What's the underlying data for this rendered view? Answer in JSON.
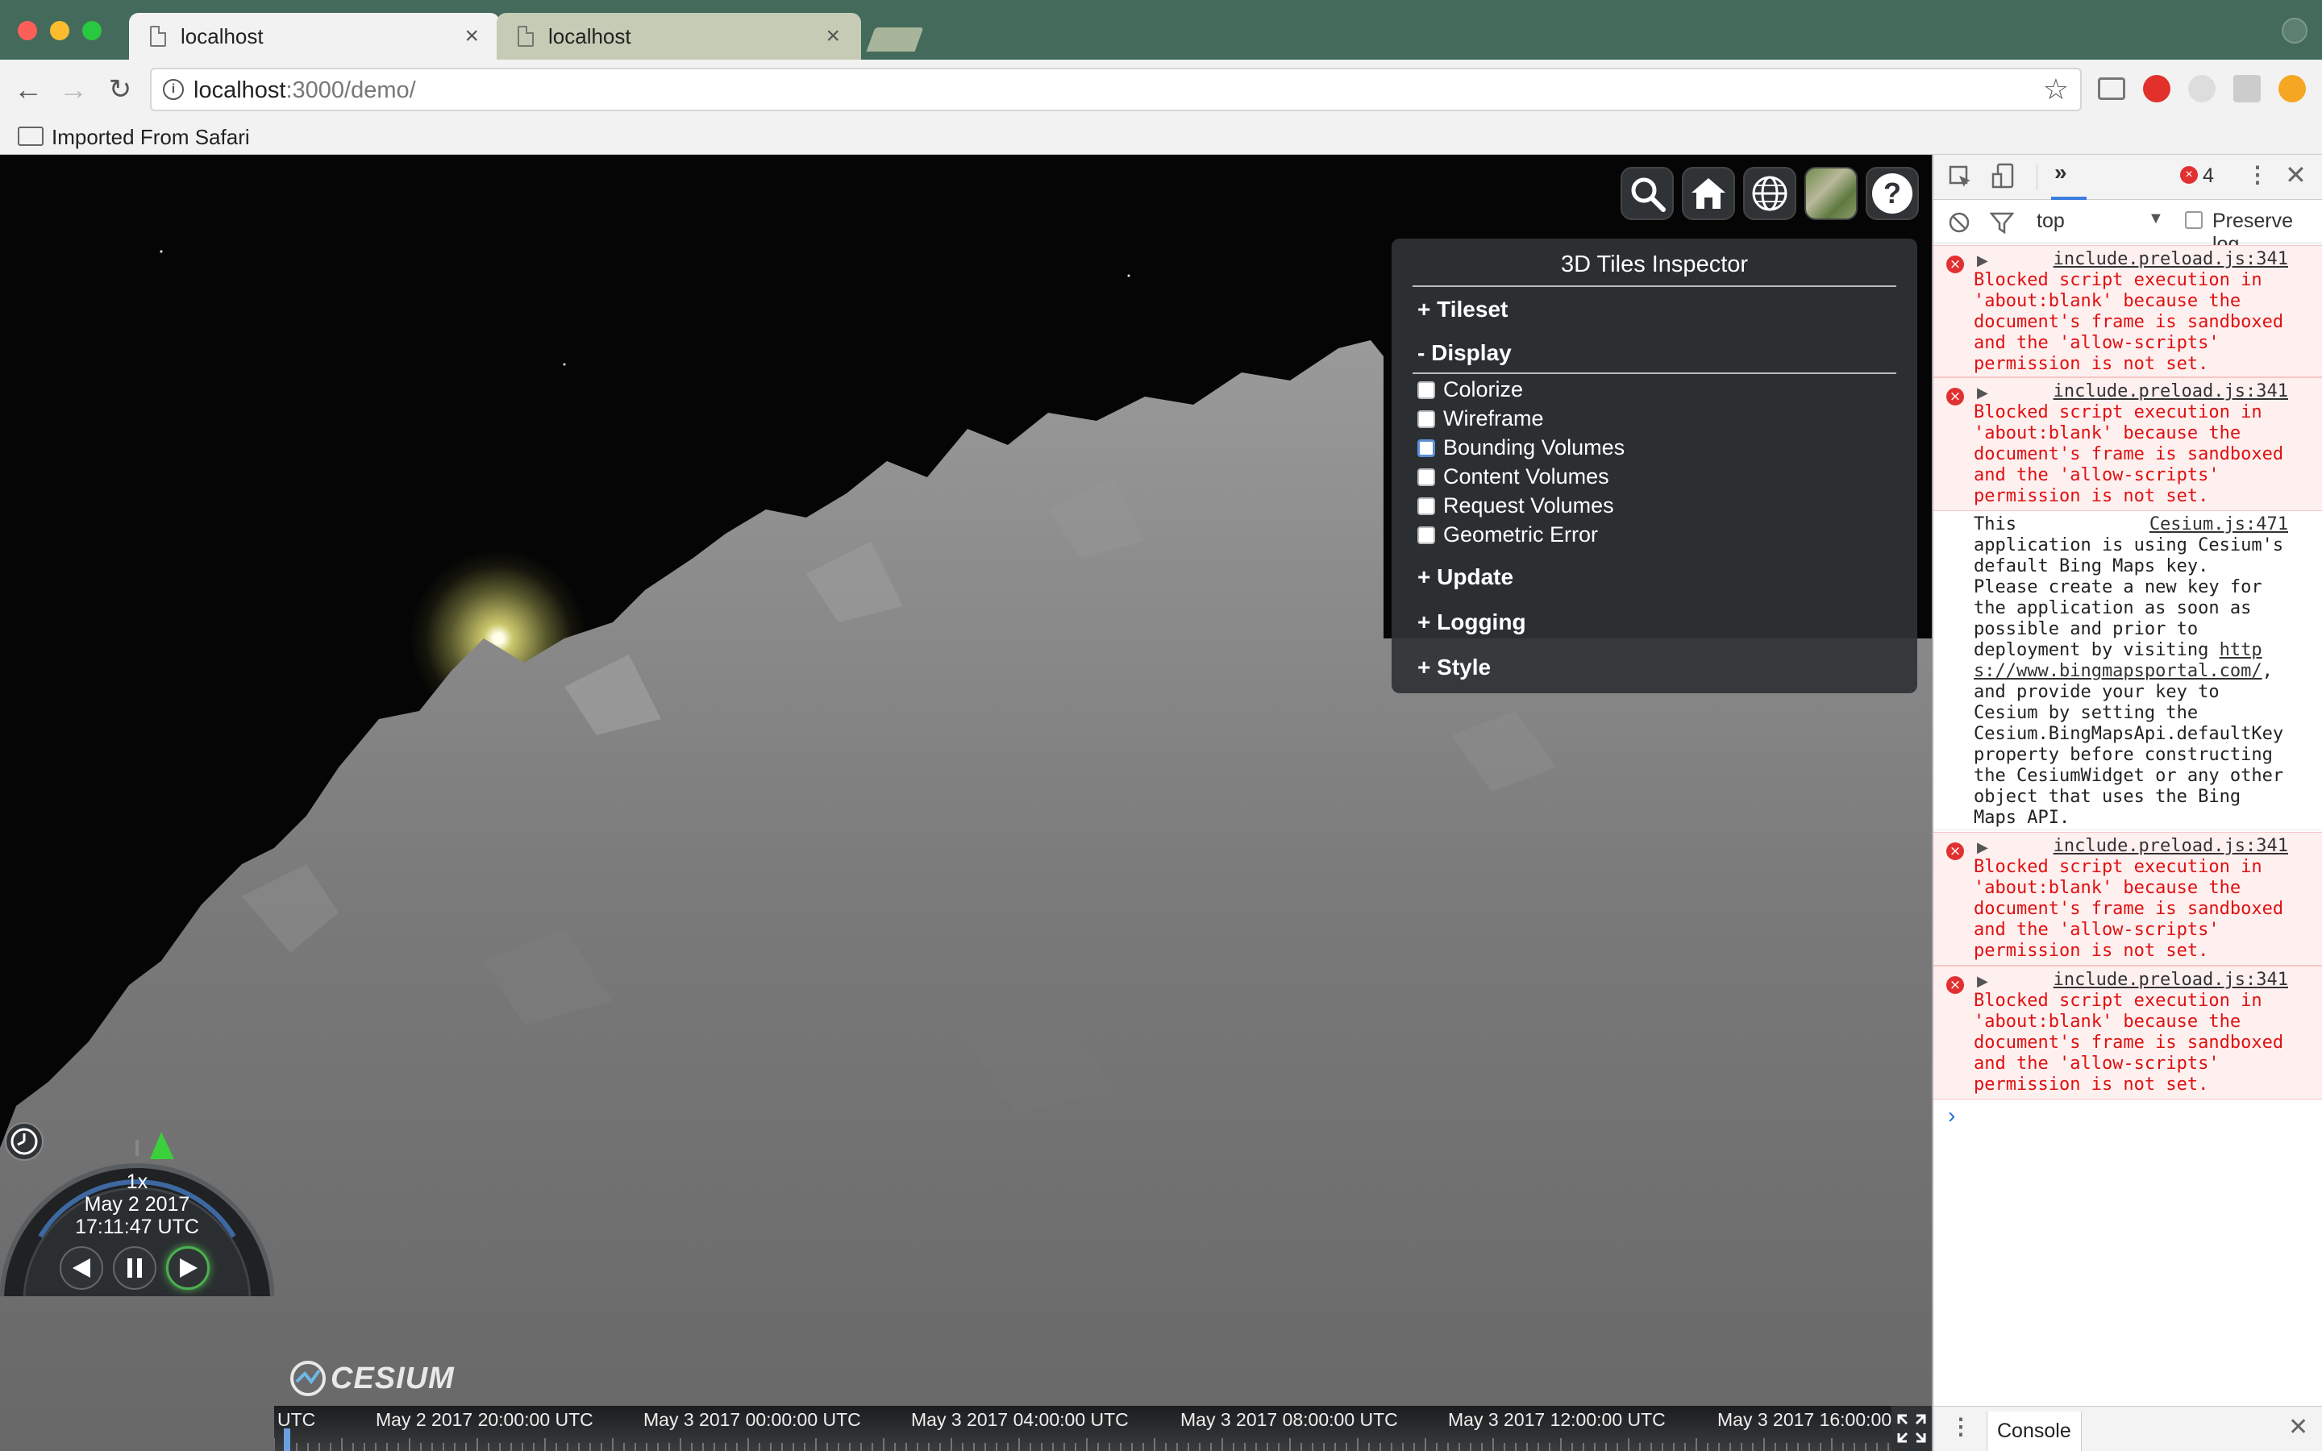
{
  "browser": {
    "tabs": [
      {
        "title": "localhost",
        "active": true
      },
      {
        "title": "localhost",
        "active": false
      }
    ],
    "address": {
      "host": "localhost",
      "path": ":3000/demo/"
    },
    "bookmark": "Imported From Safari",
    "accent": "#436a5b"
  },
  "viewer": {
    "toolbar_icons": [
      "search-icon",
      "home-icon",
      "globe-icon",
      "imagery-layer-icon",
      "help-icon"
    ],
    "inspector": {
      "title": "3D Tiles Inspector",
      "sections": {
        "tileset": "Tileset",
        "display": "Display",
        "update": "Update",
        "logging": "Logging",
        "style": "Style"
      },
      "section_markers": {
        "collapsed": "+",
        "expanded": "-"
      },
      "display_options": [
        {
          "label": "Colorize",
          "checked": false
        },
        {
          "label": "Wireframe",
          "checked": false
        },
        {
          "label": "Bounding Volumes",
          "checked": false
        },
        {
          "label": "Content Volumes",
          "checked": false
        },
        {
          "label": "Request Volumes",
          "checked": false
        },
        {
          "label": "Geometric Error",
          "checked": false
        }
      ]
    },
    "animation": {
      "speed": "1x",
      "date": "May 2 2017",
      "time": "17:11:47 UTC"
    },
    "timeline": {
      "labels": [
        "UTC",
        "May 2 2017 20:00:00 UTC",
        "May 3 2017 00:00:00 UTC",
        "May 3 2017 04:00:00 UTC",
        "May 3 2017 08:00:00 UTC",
        "May 3 2017 12:00:00 UTC",
        "May 3 2017 16:00:00"
      ]
    },
    "logo": "CESIUM"
  },
  "devtools": {
    "error_count": "4",
    "context": "top",
    "preserve_log": "Preserve log",
    "messages": [
      {
        "type": "error",
        "source": "include.preload.js:341",
        "text": "Blocked script execution in\n'about:blank' because the\ndocument's frame is sandboxed\nand the 'allow-scripts'\npermission is not set."
      },
      {
        "type": "error",
        "source": "include.preload.js:341",
        "text": "Blocked script execution in\n'about:blank' because the\ndocument's frame is sandboxed\nand the 'allow-scripts'\npermission is not set."
      },
      {
        "type": "log",
        "source": "Cesium.js:471",
        "text_pre": "This\napplication is using Cesium's\ndefault Bing Maps key.\nPlease create a new key for\nthe application as soon as\npossible and prior to\ndeployment by visiting ",
        "link": "http\ns://www.bingmapsportal.com/",
        "text_post": ",\nand provide your key to\nCesium by setting the\nCesium.BingMapsApi.defaultKey\nproperty before constructing\nthe CesiumWidget or any other\nobject that uses the Bing\nMaps API."
      },
      {
        "type": "error",
        "source": "include.preload.js:341",
        "text": "Blocked script execution in\n'about:blank' because the\ndocument's frame is sandboxed\nand the 'allow-scripts'\npermission is not set."
      },
      {
        "type": "error",
        "source": "include.preload.js:341",
        "text": "Blocked script execution in\n'about:blank' because the\ndocument's frame is sandboxed\nand the 'allow-scripts'\npermission is not set."
      }
    ],
    "prompt": "›",
    "drawer_tab": "Console"
  }
}
